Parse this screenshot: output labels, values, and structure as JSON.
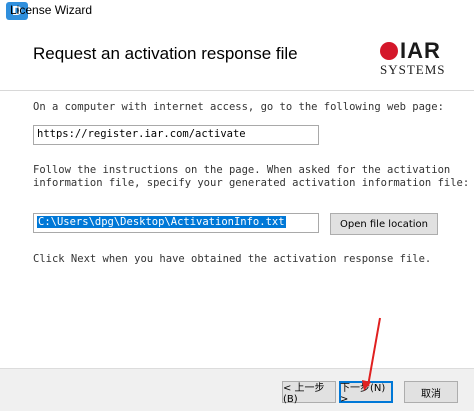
{
  "window": {
    "title": "License Wizard"
  },
  "page": {
    "heading": "Request an activation response file"
  },
  "logo": {
    "line1": "IAR",
    "line2": "SYSTEMS",
    "accent_color": "#d4172a"
  },
  "instructions": {
    "step1": "On a computer with internet access, go to the following web page:",
    "url": "https://register.iar.com/activate",
    "step2_line1": "Follow the instructions on the page. When asked for the activation",
    "step2_line2": "information file, specify your generated activation information file:",
    "file_path": "C:\\Users\\dpg\\Desktop\\ActivationInfo.txt",
    "step3": "Click Next when you have obtained the activation response file."
  },
  "buttons": {
    "open_file_location": "Open file location",
    "back": "< 上一步(B)",
    "next": "下一步(N) >",
    "cancel": "取消"
  },
  "colors": {
    "selection": "#0078d7",
    "annotation_arrow": "#e02020"
  }
}
